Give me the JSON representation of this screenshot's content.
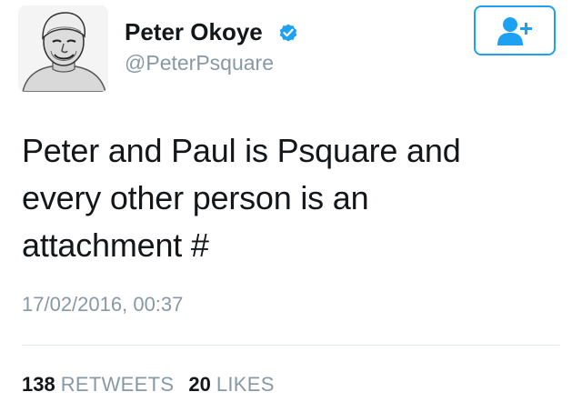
{
  "author": {
    "display_name": "Peter Okoye",
    "handle": "@PeterPsquare",
    "verified": true
  },
  "follow_button": {
    "icon": "add-user-icon",
    "color": "#1da1f2"
  },
  "tweet": {
    "text_lines": [
      "Peter and Paul is Psquare and",
      "every other person is an",
      "attachment #"
    ],
    "timestamp": "17/02/2016, 00:37"
  },
  "stats": {
    "retweets_count": "138",
    "retweets_label": "RETWEETS",
    "likes_count": "20",
    "likes_label": "LIKES"
  },
  "colors": {
    "accent": "#1da1f2",
    "text": "#14171a",
    "muted": "#8899a6",
    "divider": "#e1e8ed"
  }
}
